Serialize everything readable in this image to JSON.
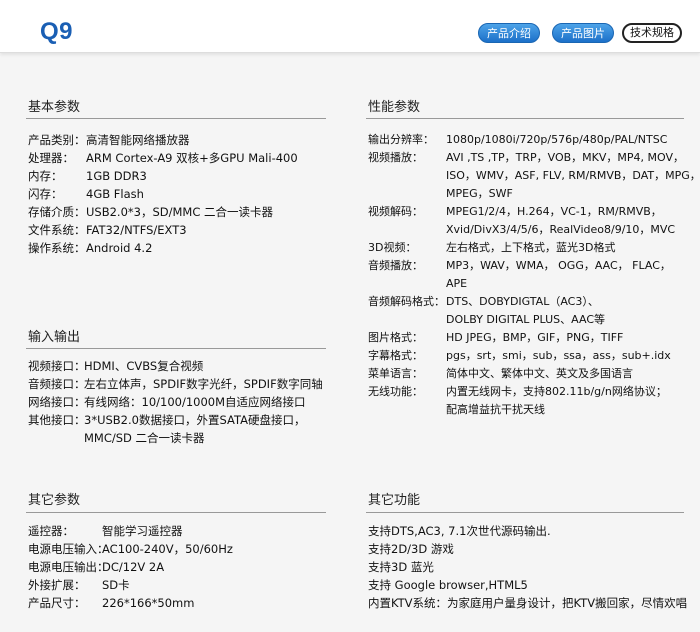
{
  "header": {
    "model": "Q9",
    "tabs": [
      "产品介绍",
      "产品图片",
      "技术规格"
    ]
  },
  "basic": {
    "title": "基本参数",
    "rows": [
      {
        "label": "产品类别：",
        "value": "高清智能网络播放器"
      },
      {
        "label": "处理器：",
        "value": "ARM Cortex-A9  双核+多GPU Mali-400"
      },
      {
        "label": "内存：",
        "value": "1GB DDR3"
      },
      {
        "label": "闪存：",
        "value": "4GB Flash"
      },
      {
        "label": "存储介质：",
        "value": "USB2.0*3，SD/MMC  二合一读卡器"
      },
      {
        "label": "文件系统：",
        "value": "FAT32/NTFS/EXT3"
      },
      {
        "label": "操作系统：",
        "value": "Android 4.2"
      }
    ]
  },
  "io": {
    "title": "输入输出",
    "rows": [
      {
        "label": "视频接口：",
        "value": "HDMI、CVBS复合视频"
      },
      {
        "label": "音频接口：",
        "value": "左右立体声，SPDIF数字光纤，SPDIF数字同轴"
      },
      {
        "label": "网络接口：",
        "value": "有线网络：10/100/1000M自适应网络接口"
      },
      {
        "label": "其他接口：",
        "value": "3*USB2.0数据接口，外置SATA硬盘接口，"
      },
      {
        "label": "",
        "value": "MMC/SD 二合一读卡器"
      }
    ]
  },
  "other": {
    "title": "其它参数",
    "rows": [
      {
        "label": "遥控器：",
        "value": "智能学习遥控器"
      },
      {
        "label": "电源电压输入：",
        "value": "AC100-240V，50/60Hz"
      },
      {
        "label": "电源电压输出：",
        "value": "DC/12V 2A"
      },
      {
        "label": "外接扩展：",
        "value": "SD卡"
      },
      {
        "label": "产品尺寸：",
        "value": "226*166*50mm"
      }
    ]
  },
  "perf": {
    "title": "性能参数",
    "rows": [
      {
        "label": "输出分辨率：",
        "value": "1080p/1080i/720p/576p/480p/PAL/NTSC"
      },
      {
        "label": "视频播放：",
        "value": "AVI ,TS ,TP，TRP，VOB，MKV，MP4, MOV，"
      },
      {
        "label": "",
        "value": "ISO，WMV，ASF, FLV, RM/RMVB，DAT，MPG，"
      },
      {
        "label": "",
        "value": "MPEG，SWF"
      },
      {
        "label": "视频解码：",
        "value": "MPEG1/2/4，H.264，VC-1，RM/RMVB，"
      },
      {
        "label": "",
        "value": "Xvid/DivX3/4/5/6，RealVideo8/9/10，MVC"
      },
      {
        "label": "3D视频：",
        "value": "左右格式，上下格式，蓝光3D格式"
      },
      {
        "label": "音频播放：",
        "value": "MP3，WAV，WMA， OGG，AAC， FLAC，"
      },
      {
        "label": "",
        "value": "APE"
      },
      {
        "label": "音频解码格式：",
        "value": "DTS、DOBYDIGTAL（AC3）、"
      },
      {
        "label": "",
        "value": "DOLBY  DIGITAL PLUS、AAC等"
      },
      {
        "label": "图片格式：",
        "value": "HD JPEG，BMP，GIF，PNG，TIFF"
      },
      {
        "label": "字幕格式：",
        "value": "pgs，srt，smi，sub，ssa，ass，sub+.idx"
      },
      {
        "label": "菜单语言：",
        "value": "简体中文、繁体中文、英文及多国语言"
      },
      {
        "label": "无线功能：",
        "value": "内置无线网卡，支持802.11b/g/n网络协议；"
      },
      {
        "label": "",
        "value": "配高增益抗干扰天线"
      }
    ]
  },
  "features": {
    "title": "其它功能",
    "lines": [
      "支持DTS,AC3, 7.1次世代源码输出.",
      "支持2D/3D 游戏",
      "支持3D 蓝光",
      "支持 Google browser,HTML5",
      "内置KTV系统：为家庭用户量身设计，把KTV搬回家，尽情欢唱"
    ]
  }
}
